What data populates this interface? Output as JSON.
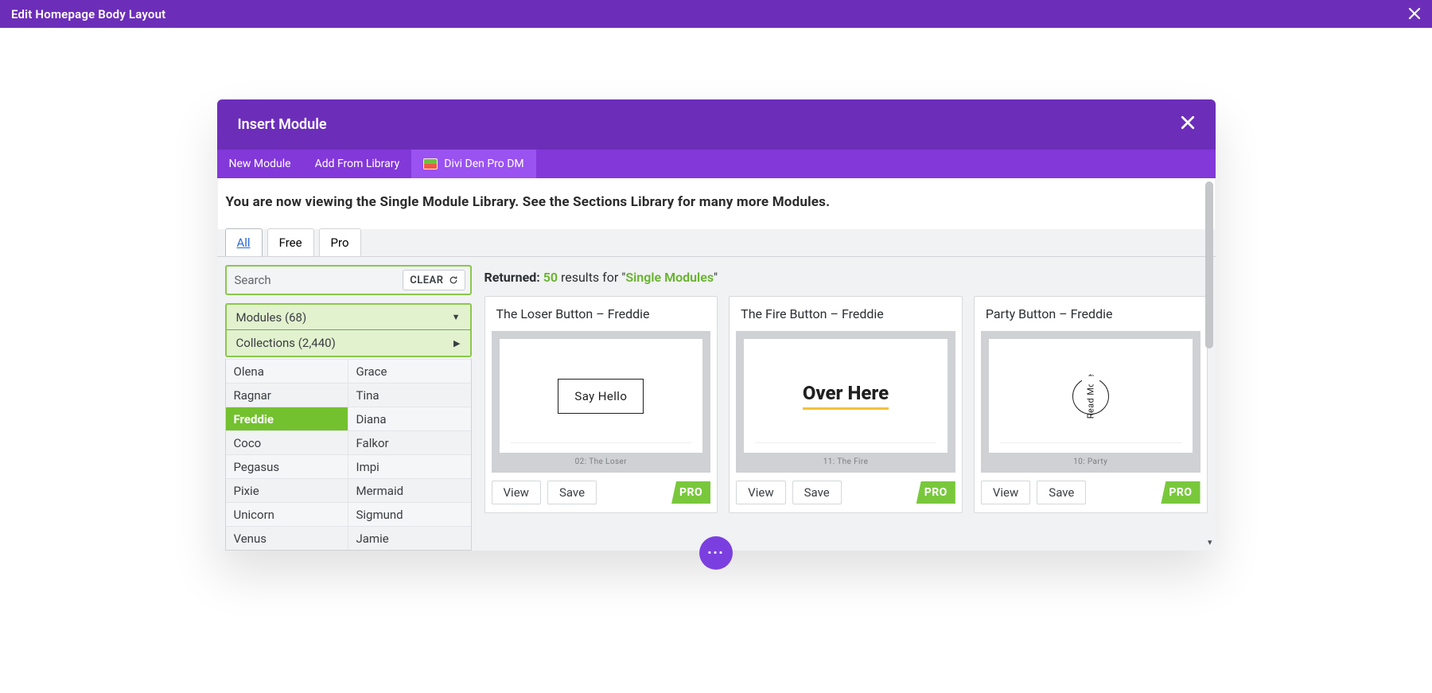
{
  "topbar": {
    "title": "Edit Homepage Body Layout"
  },
  "modal": {
    "title": "Insert Module",
    "tabs": [
      {
        "label": "New Module"
      },
      {
        "label": "Add From Library"
      },
      {
        "label": "Divi Den Pro DM"
      }
    ]
  },
  "info_strip": "You are now viewing the Single Module Library. See the Sections Library for many more Modules.",
  "filter_tabs": [
    {
      "label": "All"
    },
    {
      "label": "Free"
    },
    {
      "label": "Pro"
    }
  ],
  "search": {
    "placeholder": "Search",
    "clear_label": "CLEAR"
  },
  "accordion": {
    "modules": "Modules (68)",
    "collections": "Collections (2,440)"
  },
  "collections_list": [
    "Olena",
    "Grace",
    "Ragnar",
    "Tina",
    "Freddie",
    "Diana",
    "Coco",
    "Falkor",
    "Pegasus",
    "Impi",
    "Pixie",
    "Mermaid",
    "Unicorn",
    "Sigmund",
    "Venus",
    "Jamie"
  ],
  "selected_collection": "Freddie",
  "returned": {
    "label": "Returned:",
    "count": "50",
    "mid": "results for \"",
    "query": "Single Modules",
    "end": "\""
  },
  "cards": [
    {
      "title": "The Loser Button – Freddie",
      "caption": "02: The Loser",
      "preview": {
        "type": "loser",
        "text": "Say Hello"
      },
      "view": "View",
      "save": "Save",
      "badge": "PRO"
    },
    {
      "title": "The Fire Button – Freddie",
      "caption": "11: The Fire",
      "preview": {
        "type": "fire",
        "text": "Over Here"
      },
      "view": "View",
      "save": "Save",
      "badge": "PRO"
    },
    {
      "title": "Party Button – Freddie",
      "caption": "10: Party",
      "preview": {
        "type": "party",
        "text": "Read More"
      },
      "view": "View",
      "save": "Save",
      "badge": "PRO"
    }
  ]
}
